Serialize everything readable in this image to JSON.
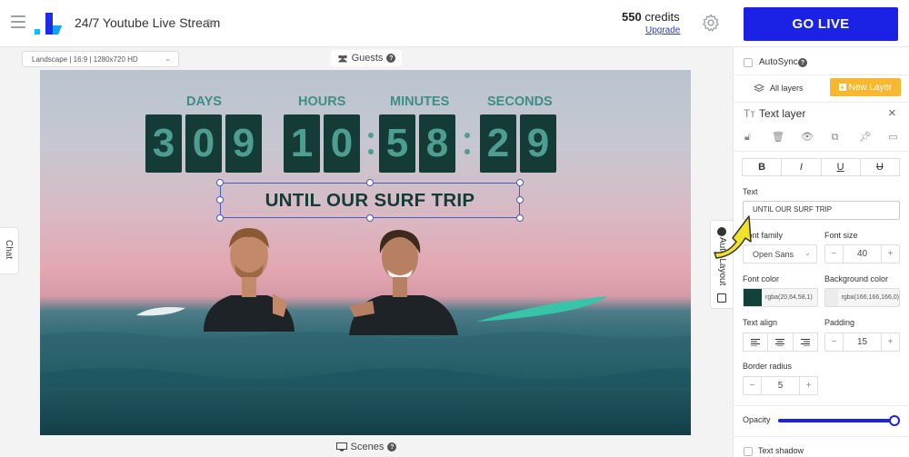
{
  "header": {
    "title": "24/7 Youtube Live Stream",
    "credits_value": "550",
    "credits_label": "credits",
    "upgrade": "Upgrade",
    "go_live": "GO LIVE"
  },
  "stage": {
    "resolution": "Landscape | 16:9 | 1280x720 HD",
    "guests": "Guests",
    "scenes": "Scenes",
    "chat": "Chat",
    "auto_layout": "Auto Layout"
  },
  "countdown": {
    "labels": [
      "DAYS",
      "HOURS",
      "MINUTES",
      "SECONDS"
    ],
    "days": [
      "3",
      "0",
      "9"
    ],
    "hours": [
      "1",
      "0"
    ],
    "minutes": [
      "5",
      "8"
    ],
    "seconds": [
      "2",
      "9"
    ],
    "caption": "UNTIL OUR SURF TRIP",
    "digit_bg": "#143b36",
    "digit_color": "#4d9e8f",
    "label_color": "#3d8f84"
  },
  "panel": {
    "autosync": "AutoSync",
    "all_layers": "All layers",
    "new_layer": "New Layer",
    "layer_title": "Text layer",
    "format": {
      "bold": "B",
      "italic": "I",
      "underline": "U",
      "strike": "U"
    },
    "text_label": "Text",
    "text_value": "UNTIL OUR SURF TRIP",
    "font_family_label": "Font family",
    "font_family_value": "Open Sans",
    "font_size_label": "Font size",
    "font_size_value": "40",
    "font_color_label": "Font color",
    "font_color_value": "rgba(20,64,58,1)",
    "font_color_hex": "#14403a",
    "bg_color_label": "Background color",
    "bg_color_value": "rgba(166,166,166,0)",
    "text_align_label": "Text align",
    "padding_label": "Padding",
    "padding_value": "15",
    "border_radius_label": "Border radius",
    "border_radius_value": "5",
    "opacity_label": "Opacity",
    "opacity_level": 1.0,
    "text_shadow": "Text shadow",
    "minus": "−",
    "plus": "+"
  },
  "colors": {
    "accent": "#1b22e6",
    "new_layer_bg": "#f7b731"
  }
}
